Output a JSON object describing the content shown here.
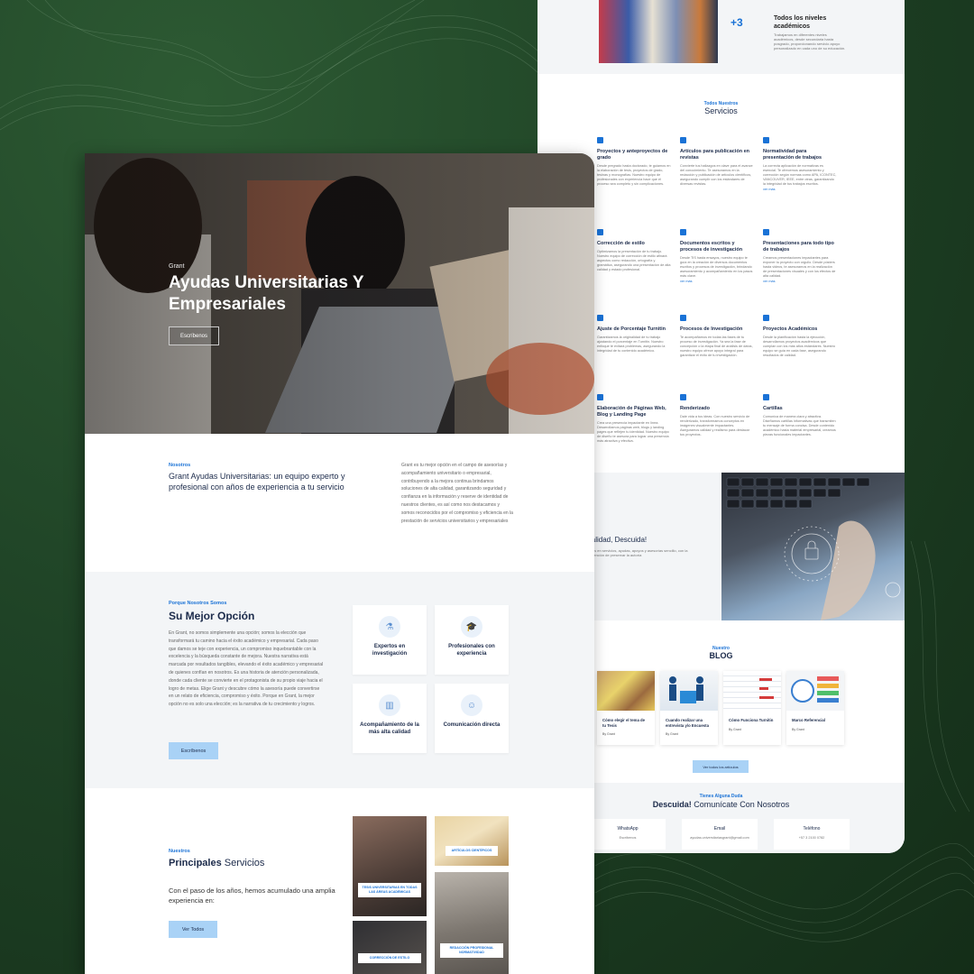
{
  "colors": {
    "background": "#1d3f23",
    "accent": "#1a72d6",
    "button": "#a9d2f6",
    "heading": "#1b2a4a"
  },
  "back_page": {
    "top_plus": "+3",
    "top_title": "Todos los niveles académicos",
    "top_text": "Trabajamos en diferentes niveles académicos, desde secundaria hasta posgrado, proporcionando servicio apoyo personalizado en cada uno de su educación.",
    "services": {
      "kicker": "Todos Nuestros",
      "title": "Servicios",
      "items": [
        {
          "title": "Proyectos y anteproyectos de grado",
          "text": "Desde pregrado hasta doctorado, te guiamos en la elaboración de tesis, proyectos de grado, tesinas y monografías. Nuestro equipo de profesionales con experiencia hace que el proceso sea completo y sin complicaciones.",
          "more": ""
        },
        {
          "title": "Artículos para publicación en revistas",
          "text": "Convierte tus hallazgos en clave para el avance del conocimiento. Te asesoramos en la redacción y publicación de artículos científicos, asegurando cumplir con los estándares de diversas revistas.",
          "more": ""
        },
        {
          "title": "Normatividad para presentación de trabajos",
          "text": "La correcta aplicación de normativas es esencial. Te ofrecemos asesoramiento y corrección según normas como APA, ICONTEC, VANCOUVER, IEEE, entre otras, garantizando la integridad de tus trabajos escritos.",
          "more": "ver más"
        },
        {
          "title": "Corrección de estilo",
          "text": "Optimizamos la presentación de tu trabajo. Nuestro equipo de corrección de estilo afinará aspectos como redacción, ortografía y gramática, asegurando una presentación de alta calidad y estado profesional.",
          "more": ""
        },
        {
          "title": "Documentos escritos y procesos de investigación",
          "text": "Desde TIS hasta ensayos, nuestro equipo te guía en la creación de diversos documentos escritos y procesos de investigación, brindando asesoramiento y acompañamiento en los pasos más clave.",
          "more": "ver más"
        },
        {
          "title": "Presentaciones para todo tipo de trabajos",
          "text": "Creamos presentaciones impactantes para exponer tu proyecto con orgullo. Desde pósters hasta videos, te asesoramos en la realización de presentaciones visuales y con los efectos de alta calidad.",
          "more": "ver más"
        },
        {
          "title": "Ajuste de Porcentaje Turnitin",
          "text": "Garantizamos la originalidad de tu trabajo ajustando el porcentaje en Turnitin. Nuestro enfoque te evitará problemas, asegurando la integridad de tu contenido académico.",
          "more": ""
        },
        {
          "title": "Procesos de Investigación",
          "text": "Te acompañamos en todas las fases de tu proceso de investigación. Ya sea la fase de concepción o la etapa final de análisis de datos, nuestro equipo ofrece apoyo integral para garantizar el éxito de tu investigación.",
          "more": ""
        },
        {
          "title": "Proyectos Académicos",
          "text": "Desde la planificación hasta la ejecución, desarrollamos proyectos académicos que cumplan con los más altos estándares. Nuestro equipo se guía en cada fase, asegurando resultados de calidad.",
          "more": ""
        },
        {
          "title": "Elaboración de Páginas Web, Blog y Landing Page",
          "text": "Crea una presencia impactante en línea. Desarrollamos páginas web, blogs y landing pages que reflejen tu identidad. Nuestro equipo de diseño te asesora para lograr una presencia más atractiva y efectiva.",
          "more": ""
        },
        {
          "title": "Renderizado",
          "text": "Dale vida a tus ideas. Con nuestro servicio de renderizado, transformamos conceptos en imágenes visualmente impactantes. Aseguramos calidad y realismo para destacar tus proyectos.",
          "more": ""
        },
        {
          "title": "Cartillas",
          "text": "Comunica de manera clara y atractiva. Diseñamos cartillas informativas que transmiten tu mensaje de forma concisa. Desde contenido académico hasta material empresarial, creamos piezas funcionales impactantes.",
          "more": ""
        }
      ]
    },
    "confid": {
      "title": "ialidad, Descuida!",
      "text": "ivos en servicios, ayudas, apoyos y asesorías sencillo, con la intención de preservar la autoría"
    },
    "blog": {
      "kicker": "Nuestro",
      "title": "BLOG",
      "cards": [
        {
          "title": "Cómo elegir el tema de tu Tesis",
          "by": "By Grant"
        },
        {
          "title": "Cuando realizar una entrevista y/o Encuesta",
          "by": "By Grant"
        },
        {
          "title": "Cómo Funciona Turnitin",
          "by": "By Grant"
        },
        {
          "title": "Marco Referencial",
          "by": "By Grant"
        }
      ],
      "button": "Ver todos los artículos"
    },
    "contact": {
      "kicker": "Tienes Alguna Duda",
      "title_bold": "Descuida!",
      "title_rest": " Comunícate Con Nosotros",
      "cards": [
        {
          "label": "WhatsApp",
          "value": "Escribenos"
        },
        {
          "label": "Email",
          "value": "ayudas.universitariasgrant@gmail.com"
        },
        {
          "label": "Teléfono",
          "value": "+57 3 2100 0782"
        }
      ]
    }
  },
  "front_page": {
    "hero": {
      "brand": "Grant",
      "title": "Ayudas Universitarias Y Empresariales",
      "button": "Escríbenos"
    },
    "about": {
      "kicker": "Nosotros",
      "title": "Grant Ayudas Universitarias: un equipo experto y profesional con años de experiencia a tu servicio",
      "text": "Grant es tu mejor opción en el campo de asesorías y acompañamiento universitario o empresarial, contribuyendo a la mejora continua brindamos soluciones de alta calidad, garantizando seguridad y confianza en la información y reserve de identidad de nuestros clientes, es así como nos destacamos y somos reconocidos por el compromiso y eficiencia en la prestación de servicios universitarios y empresariales"
    },
    "why": {
      "kicker": "Porque Nosotros Somos",
      "title": "Su Mejor Opción",
      "text": "En Grant, no somos simplemente una opción; somos la elección que transformará tu camino hacia el éxito académico y empresarial. Cada paso que damos se teje con experiencia, un compromiso inquebrantable con la excelencia y la búsqueda constante de mejora. Nuestra narrativa está marcada por resultados tangibles, elevando el éxito académico y empresarial de quienes confían en nosotros. Es una historia de atención personalizada, donde cada cliente se convierte en el protagonista de su propio viaje hacia el logro de metas. Elige Grant y descubre cómo la asesoría puede convertirse en un relato de eficiencia, compromiso y éxito. Porque en Grant, la mejor opción no es solo una elección; es la narrativa de tu crecimiento y logros.",
      "button": "Escríbenos",
      "features": [
        {
          "label": "Expertos en investigación",
          "icon": "microscope-icon"
        },
        {
          "label": "Profesionales con experiencia",
          "icon": "graduate-icon"
        },
        {
          "label": "Acompañamiento de la más alta calidad",
          "icon": "building-icon"
        },
        {
          "label": "Comunicación directa",
          "icon": "team-icon"
        }
      ]
    },
    "principales": {
      "kicker": "Nuestros",
      "title_bold": "Principales",
      "title_rest": " Servicios",
      "text": "Con el paso de los años, hemos acumulado una amplia experiencia en:",
      "button": "Ver Todos",
      "tiles": [
        "TESIS UNIVERSITARIAS EN TODAS LAS ÁREAS ACADÉMICAS",
        "ARTÍCULOS CIENTÍFICOS",
        "CORRECCIÓN DE ESTILO",
        "REDACCIÓN PROFESIONAL NORMATIVIDAD"
      ]
    }
  }
}
